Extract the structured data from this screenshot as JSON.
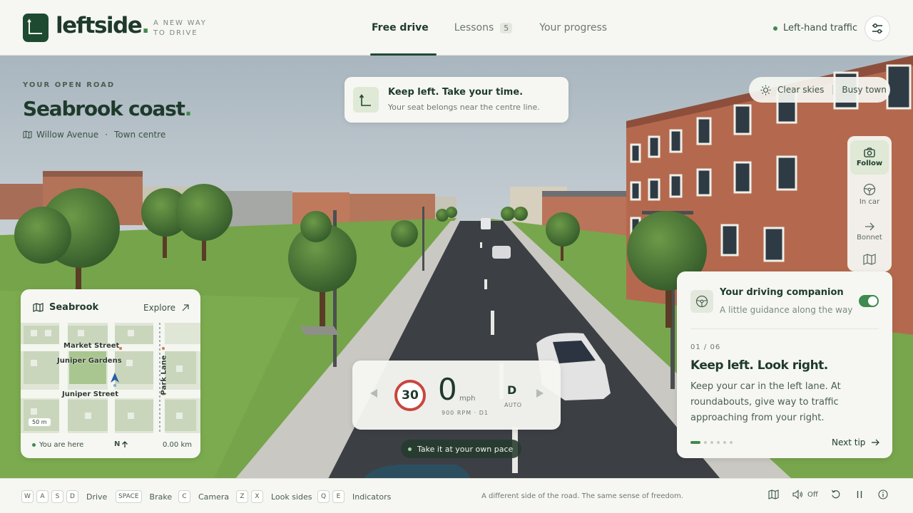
{
  "brand": {
    "name": "leftside",
    "dot": ".",
    "tagline": "A NEW WAY TO DRIVE"
  },
  "nav": {
    "items": [
      {
        "label": "Free drive",
        "active": true
      },
      {
        "label": "Lessons",
        "badge": "5"
      },
      {
        "label": "Your progress"
      }
    ]
  },
  "traffic_mode": "Left-hand traffic",
  "location": {
    "kicker": "YOUR OPEN ROAD",
    "title": "Seabrook coast",
    "title_dot": ".",
    "street": "Willow Avenue",
    "separator": "·",
    "area": "Town centre"
  },
  "instruction": {
    "title": "Keep left. Take your time.",
    "subtitle": "Your seat belongs near the centre line."
  },
  "weather": {
    "sky": "Clear skies",
    "traffic": "Busy town"
  },
  "camera": {
    "options": [
      {
        "label": "Follow",
        "icon": "camera-icon",
        "active": true
      },
      {
        "label": "In car",
        "icon": "steering-wheel-icon"
      },
      {
        "label": "Bonnet",
        "icon": "arrow-right-icon"
      },
      {
        "label": "",
        "icon": "map-icon"
      }
    ]
  },
  "minimap": {
    "title": "Seabrook",
    "explore": "Explore",
    "streets": {
      "market": "Market Street",
      "gardens": "Juniper Gardens",
      "juniper": "Juniper Street",
      "park": "Park Lane"
    },
    "scale": "50 m",
    "you_are_here": "You are here",
    "heading": "N",
    "distance": "0.00 km"
  },
  "dashboard": {
    "speed_limit": "30",
    "speed": "0",
    "unit": "mph",
    "rpm": "900 RPM · D1",
    "gear": "D",
    "transmission": "AUTO"
  },
  "pace_hint": "Take it at your own pace",
  "companion": {
    "title": "Your driving companion",
    "subtitle": "A little guidance along the way",
    "enabled": true,
    "tip_count": "01 / 06",
    "tip_title": "Keep left. Look right.",
    "tip_body": "Keep your car in the left lane. At roundabouts, give way to traffic approaching from your right.",
    "next": "Next tip",
    "tip_index": 1,
    "tip_total": 6
  },
  "controls": [
    {
      "keys": [
        "W",
        "A",
        "S",
        "D"
      ],
      "label": "Drive"
    },
    {
      "keys": [
        "SPACE"
      ],
      "label": "Brake"
    },
    {
      "keys": [
        "C"
      ],
      "label": "Camera"
    },
    {
      "keys": [
        "Z",
        "X"
      ],
      "label": "Look sides"
    },
    {
      "keys": [
        "Q",
        "E"
      ],
      "label": "Indicators"
    }
  ],
  "footer_tagline": "A different side of the road. The same sense of freedom.",
  "sound": "Off",
  "colors": {
    "brand_green": "#1e4a32",
    "accent_green": "#3f8a4e",
    "speed_limit_red": "#c9463d"
  }
}
